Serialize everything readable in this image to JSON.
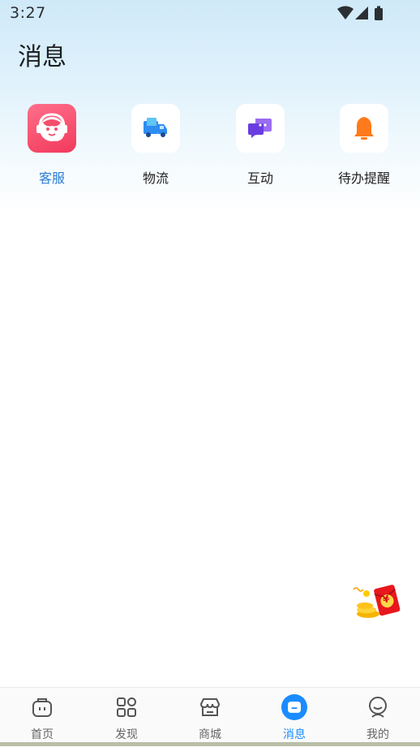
{
  "status_bar": {
    "time": "3:27"
  },
  "header": {
    "title": "消息"
  },
  "shortcuts": [
    {
      "label": "客服",
      "icon": "customer-service-icon",
      "active": true
    },
    {
      "label": "物流",
      "icon": "delivery-truck-icon",
      "active": false
    },
    {
      "label": "互动",
      "icon": "chat-bubble-icon",
      "active": false
    },
    {
      "label": "待办提醒",
      "icon": "bell-icon",
      "active": false
    }
  ],
  "floating_badge": {
    "symbol": "¥"
  },
  "tabbar": {
    "items": [
      {
        "label": "首页",
        "icon": "home-icon"
      },
      {
        "label": "发现",
        "icon": "discover-grid-icon"
      },
      {
        "label": "商城",
        "icon": "store-icon"
      },
      {
        "label": "消息",
        "icon": "message-icon",
        "active": true
      },
      {
        "label": "我的",
        "icon": "profile-icon"
      }
    ]
  },
  "colors": {
    "accent": "#1a8cff",
    "active_label": "#2b7cd3",
    "header_gradient_top": "#cfe9f8",
    "service_tile": "#f23a5c"
  }
}
